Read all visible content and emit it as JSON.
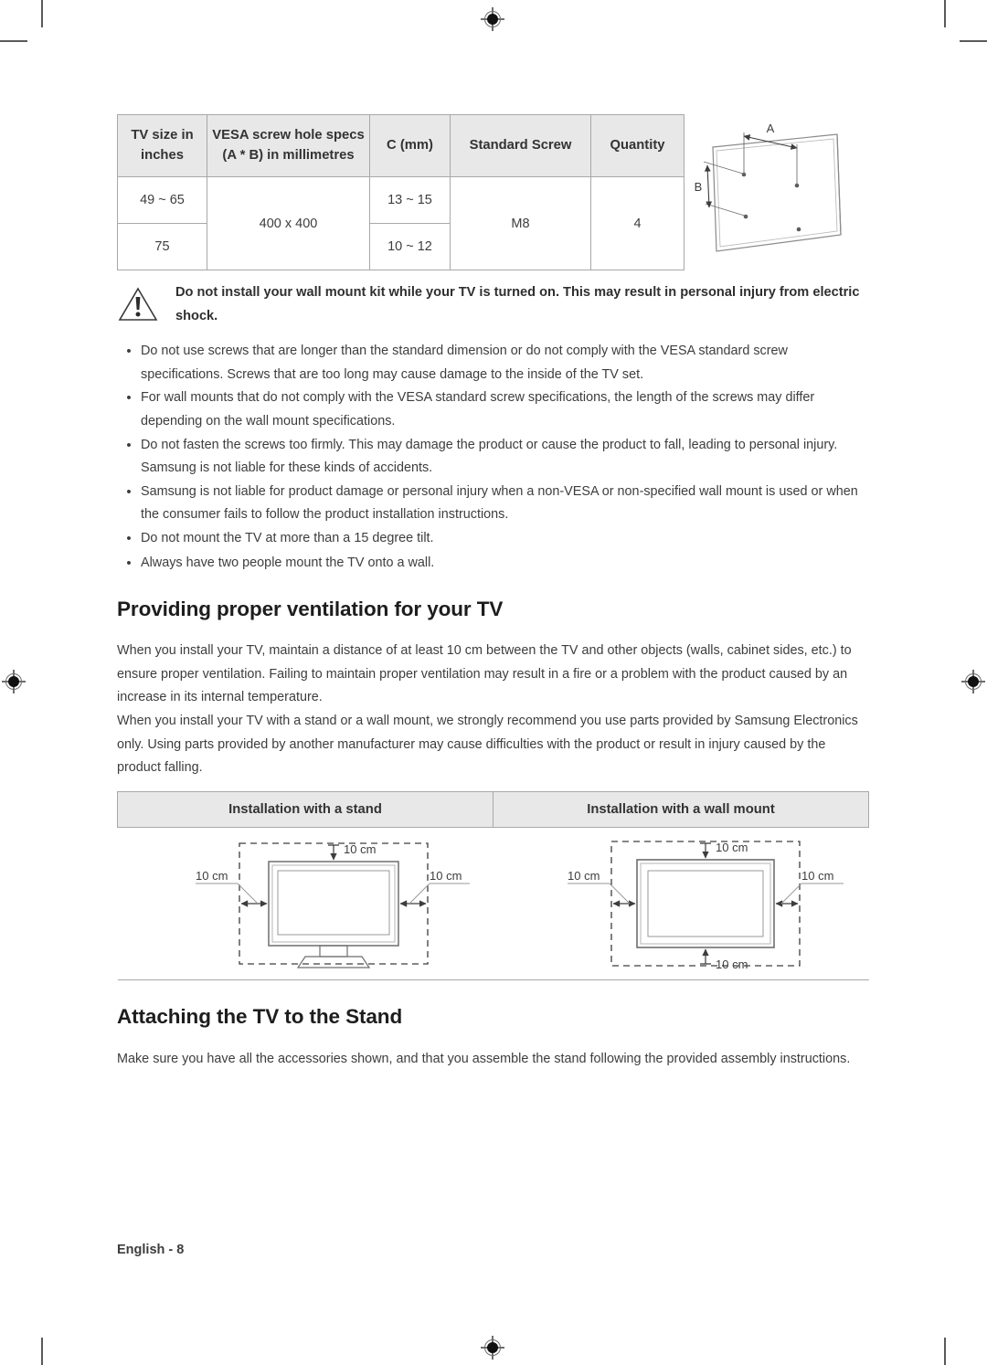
{
  "document": {
    "footer_label": "English - 8"
  },
  "vesa_table": {
    "headers": [
      "TV size in\ninches",
      "VESA screw hole specs\n(A * B) in millimetres",
      "C (mm)",
      "Standard Screw",
      "Quantity"
    ],
    "header_size_line1": "TV size in",
    "header_size_line2": "inches",
    "header_vesa_line1": "VESA screw hole specs",
    "header_vesa_line2": "(A * B) in millimetres",
    "header_c": "C (mm)",
    "header_screw": "Standard Screw",
    "header_quantity": "Quantity",
    "rows": [
      {
        "size": "49 ~ 65",
        "vesa": "400 x 400",
        "c": "13 ~ 15",
        "screw": "M8",
        "quantity": "4"
      },
      {
        "size": "75",
        "vesa": "400 x 400",
        "c": "10 ~ 12",
        "screw": "M8",
        "quantity": "4"
      }
    ],
    "cell_size_row1": "49 ~ 65",
    "cell_size_row2": "75",
    "cell_vesa": "400 x 400",
    "cell_c_row1": "13 ~ 15",
    "cell_c_row2": "10 ~ 12",
    "cell_screw": "M8",
    "cell_quantity": "4"
  },
  "tv_rear_figure": {
    "label_a": "A",
    "label_b": "B"
  },
  "warning": {
    "icon": "warning-triangle-icon",
    "text": "Do not install your wall mount kit while your TV is turned on. This may result in personal injury from electric shock."
  },
  "bullets": [
    "Do not use screws that are longer than the standard dimension or do not comply with the VESA standard screw specifications. Screws that are too long may cause damage to the inside of the TV set.",
    "For wall mounts that do not comply with the VESA standard screw specifications, the length of the screws may differ depending on the wall mount specifications.",
    "Do not fasten the screws too firmly. This may damage the product or cause the product to fall, leading to personal injury. Samsung is not liable for these kinds of accidents.",
    "Samsung is not liable for product damage or personal injury when a non-VESA or non-specified wall mount is used or when the consumer fails to follow the product installation instructions.",
    "Do not mount the TV at more than a 15 degree tilt.",
    "Always have two people mount the TV onto a wall."
  ],
  "bullet_marker": "•",
  "ventilation_section": {
    "heading": "Providing proper ventilation for your TV",
    "paragraph1": "When you install your TV, maintain a distance of at least 10 cm between the TV and other objects (walls, cabinet sides, etc.) to ensure proper ventilation. Failing to maintain proper ventilation may result in a fire or a problem with the product caused by an increase in its internal temperature.",
    "paragraph2": "When you install your TV with a stand or a wall mount, we strongly recommend you use parts provided by Samsung Electronics only. Using parts provided by another manufacturer may cause difficulties with the product or result in injury caused by the product falling."
  },
  "ventilation_table": {
    "header_stand": "Installation with a stand",
    "header_wallmount": "Installation with a wall mount",
    "stand_labels": {
      "top": "10 cm",
      "left": "10 cm",
      "right": "10 cm"
    },
    "wallmount_labels": {
      "top": "10 cm",
      "left": "10 cm",
      "right": "10 cm",
      "bottom": "10 cm"
    }
  },
  "stand_section": {
    "heading": "Attaching the TV to the Stand",
    "paragraph": "Make sure you have all the accessories shown, and that you assemble the stand following the provided assembly instructions."
  },
  "colors": {
    "header_bg": "#e8e8e8",
    "border": "#a8a8a8",
    "text": "#3d3d3d",
    "heading": "#1d1d1d"
  }
}
